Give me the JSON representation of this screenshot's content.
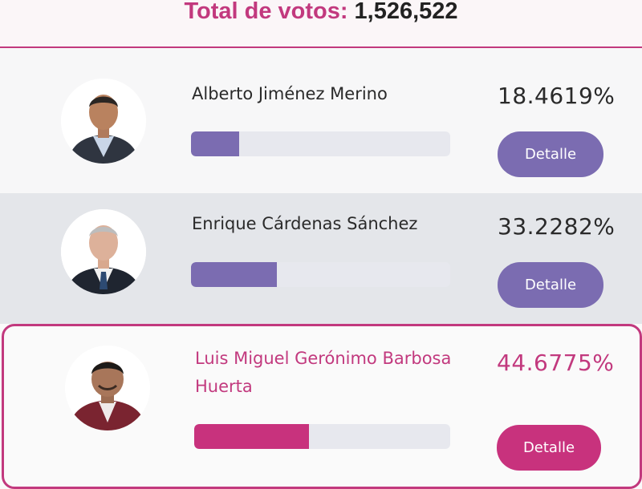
{
  "header": {
    "total_label": "Total de votos:",
    "total_value": "1,526,522"
  },
  "candidates": [
    {
      "name": "Alberto Jiménez Merino",
      "percentage_text": "18.4619%",
      "percentage": 18.4619,
      "detail_label": "Detalle",
      "leading": false
    },
    {
      "name": "Enrique Cárdenas Sánchez",
      "percentage_text": "33.2282%",
      "percentage": 33.2282,
      "detail_label": "Detalle",
      "leading": false
    },
    {
      "name_line1": "Luis Miguel Gerónimo Barbosa",
      "name_line2": "Huerta",
      "percentage_text": "44.6775%",
      "percentage": 44.6775,
      "detail_label": "Detalle",
      "leading": true
    }
  ],
  "colors": {
    "accent": "#c2397e",
    "bar_primary": "#7b6cb1",
    "bar_winner": "#c8327d",
    "track": "#e7e8ee"
  }
}
